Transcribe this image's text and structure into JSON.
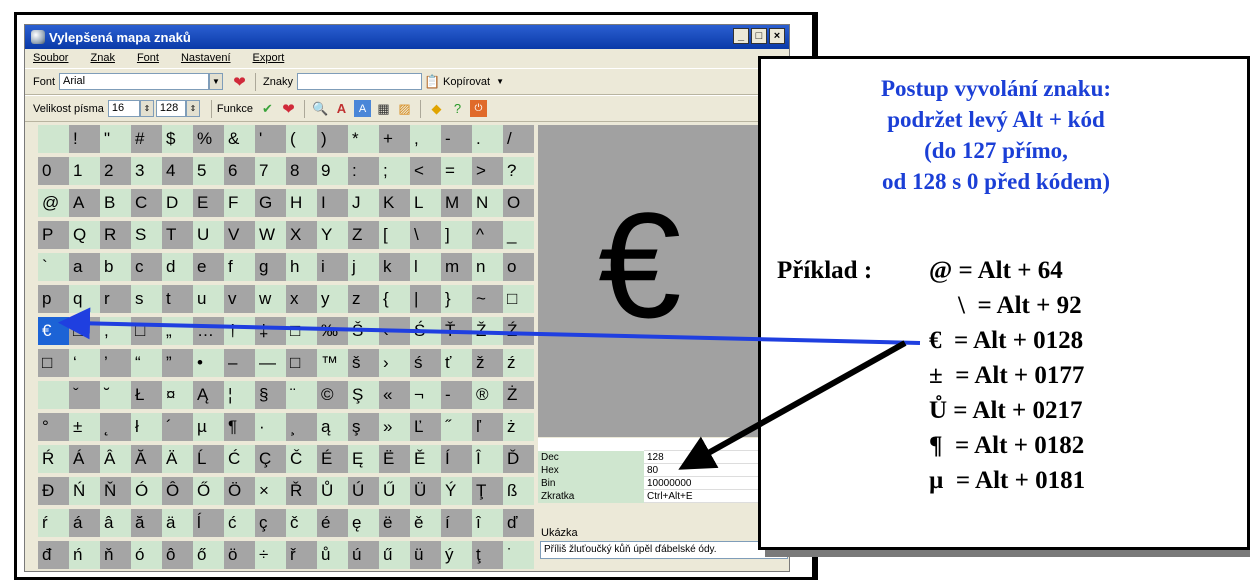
{
  "window": {
    "title": "Vylepšená mapa znaků",
    "controls": [
      "_",
      "□",
      "×"
    ]
  },
  "menu": [
    "Soubor",
    "Znak",
    "Font",
    "Nastavení",
    "Export"
  ],
  "toolbar1": {
    "font_label": "Font",
    "font_value": "Arial",
    "chars_label": "Znaky",
    "copy_label": "Kopírovat"
  },
  "toolbar2": {
    "size_label": "Velikost písma",
    "size_value": "16",
    "range_value": "128",
    "funcs_label": "Funkce"
  },
  "grid_rows": [
    [
      " ",
      "!",
      "\"",
      "#",
      "$",
      "%",
      "&",
      "'",
      "(",
      ")",
      "*",
      "+",
      ",",
      "-",
      ".",
      "/"
    ],
    [
      "0",
      "1",
      "2",
      "3",
      "4",
      "5",
      "6",
      "7",
      "8",
      "9",
      ":",
      ";",
      "<",
      "=",
      ">",
      "?"
    ],
    [
      "@",
      "A",
      "B",
      "C",
      "D",
      "E",
      "F",
      "G",
      "H",
      "I",
      "J",
      "K",
      "L",
      "M",
      "N",
      "O"
    ],
    [
      "P",
      "Q",
      "R",
      "S",
      "T",
      "U",
      "V",
      "W",
      "X",
      "Y",
      "Z",
      "[",
      "\\",
      "]",
      "^",
      "_"
    ],
    [
      "`",
      "a",
      "b",
      "c",
      "d",
      "e",
      "f",
      "g",
      "h",
      "i",
      "j",
      "k",
      "l",
      "m",
      "n",
      "o"
    ],
    [
      "p",
      "q",
      "r",
      "s",
      "t",
      "u",
      "v",
      "w",
      "x",
      "y",
      "z",
      "{",
      "|",
      "}",
      "~",
      "□"
    ],
    [
      "€",
      "□",
      ",",
      "□",
      "„",
      "…",
      "†",
      "‡",
      "□",
      "‰",
      "Š",
      "‹",
      "Ś",
      "Ť",
      "Ž",
      "Ź"
    ],
    [
      "□",
      "‘",
      "’",
      "“",
      "”",
      "•",
      "–",
      "—",
      "□",
      "™",
      "š",
      "›",
      "ś",
      "ť",
      "ž",
      "ź"
    ],
    [
      " ",
      "ˇ",
      "˘",
      "Ł",
      "¤",
      "Ą",
      "¦",
      "§",
      "¨",
      "©",
      "Ş",
      "«",
      "¬",
      "-",
      "®",
      "Ż"
    ],
    [
      "°",
      "±",
      "˛",
      "ł",
      "´",
      "µ",
      "¶",
      "·",
      "¸",
      "ą",
      "ş",
      "»",
      "Ľ",
      "˝",
      "ľ",
      "ż"
    ],
    [
      "Ŕ",
      "Á",
      "Â",
      "Ă",
      "Ä",
      "Ĺ",
      "Ć",
      "Ç",
      "Č",
      "É",
      "Ę",
      "Ë",
      "Ě",
      "Í",
      "Î",
      "Ď"
    ],
    [
      "Đ",
      "Ń",
      "Ň",
      "Ó",
      "Ô",
      "Ő",
      "Ö",
      "×",
      "Ř",
      "Ů",
      "Ú",
      "Ű",
      "Ü",
      "Ý",
      "Ţ",
      "ß"
    ],
    [
      "ŕ",
      "á",
      "â",
      "ă",
      "ä",
      "ĺ",
      "ć",
      "ç",
      "č",
      "é",
      "ę",
      "ë",
      "ě",
      "í",
      "î",
      "ď"
    ],
    [
      "đ",
      "ń",
      "ň",
      "ó",
      "ô",
      "ő",
      "ö",
      "÷",
      "ř",
      "ů",
      "ú",
      "ű",
      "ü",
      "ý",
      "ţ",
      "˙"
    ]
  ],
  "preview_char": "€",
  "info": [
    {
      "k": "Dec",
      "v": "128"
    },
    {
      "k": "Hex",
      "v": "80"
    },
    {
      "k": "Bin",
      "v": "10000000"
    },
    {
      "k": "Zkratka",
      "v": "Ctrl+Alt+E"
    }
  ],
  "sample": {
    "label": "Ukázka",
    "text": "Příliš žluťoučký kůň úpěl ďábelské ódy."
  },
  "callout": {
    "title": "Postup vyvolání znaku:\npodržet levý Alt + kód\n(do 127 přímo,\nod 128 s 0 před kódem)",
    "example_label": "Příklad :",
    "examples": [
      "@ = Alt + 64",
      "\\  = Alt + 92",
      "€  = Alt + 0128",
      "±  = Alt + 0177",
      "Ů = Alt + 0217",
      "¶  = Alt + 0182",
      "µ  = Alt + 0181"
    ]
  },
  "colors": {
    "arrow": "#1f3fe0",
    "callout_text": "#1b3fd6",
    "grid_light": "#cfe6cf",
    "grid_dark": "#a5a5a5"
  }
}
